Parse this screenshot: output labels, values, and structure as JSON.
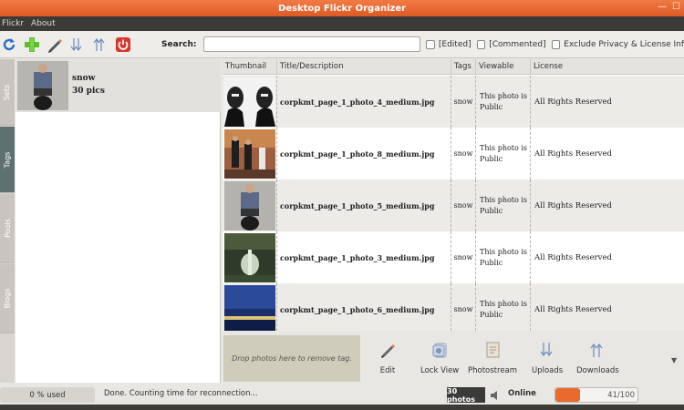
{
  "window": {
    "title": "Desktop Flickr Organizer"
  },
  "menu": {
    "items": [
      "Flickr",
      "About"
    ]
  },
  "toolbar": {
    "icons": [
      "refresh-icon",
      "add-icon",
      "edit-icon",
      "download-icon",
      "upload-icon",
      "power-icon"
    ],
    "search_label": "Search:",
    "search_value": "",
    "filters": [
      "[Edited]",
      "[Commented]",
      "Exclude Privacy & License Inf"
    ]
  },
  "side_tabs": [
    "Sets",
    "Tags",
    "Pools",
    "Blogs"
  ],
  "tags_panel": {
    "items": [
      {
        "name": "snow",
        "count": "30 pics"
      }
    ]
  },
  "grid": {
    "columns": [
      "Thumbnail",
      "Title/Description",
      "Tags",
      "Viewable",
      "License"
    ],
    "rows": [
      {
        "title": "corpkmt_page_1_photo_4_medium.jpg",
        "tags": "snow",
        "viewable": "This photo is Public",
        "license": "All Rights Reserved"
      },
      {
        "title": "corpkmt_page_1_photo_8_medium.jpg",
        "tags": "snow",
        "viewable": "This photo is Public",
        "license": "All Rights Reserved"
      },
      {
        "title": "corpkmt_page_1_photo_5_medium.jpg",
        "tags": "snow",
        "viewable": "This photo is Public",
        "license": "All Rights Reserved"
      },
      {
        "title": "corpkmt_page_1_photo_3_medium.jpg",
        "tags": "snow",
        "viewable": "This photo is Public",
        "license": "All Rights Reserved"
      },
      {
        "title": "corpkmt_page_1_photo_6_medium.jpg",
        "tags": "snow",
        "viewable": "This photo is Public",
        "license": "All Rights Reserved"
      }
    ]
  },
  "bottom": {
    "drop_text": "Drop photos here to remove tag.",
    "actions": [
      "Edit",
      "Lock View",
      "Photostream",
      "Uploads",
      "Downloads"
    ]
  },
  "status": {
    "used": "0 % used",
    "message": "Done. Counting time for reconnection...",
    "photo_count": "30 photos",
    "online": "Online",
    "progress_text": "41/100",
    "progress_fraction": 0.41
  },
  "colors": {
    "accent": "#e9692f",
    "titlebar": "#dd5a24",
    "menubar": "#3c3b37"
  }
}
